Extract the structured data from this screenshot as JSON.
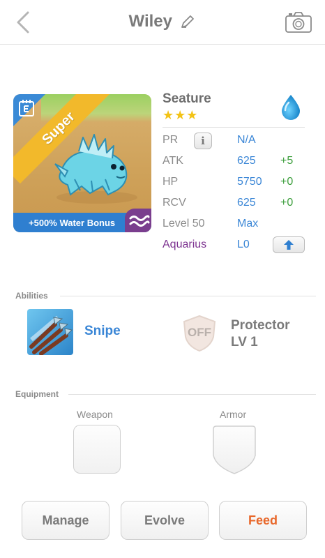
{
  "header": {
    "title": "Wiley",
    "back_icon": "chevron-left-icon",
    "edit_icon": "pencil-icon",
    "camera_icon": "camera-icon"
  },
  "monster": {
    "name": "Seature",
    "rarity_label": "Super",
    "stars": "★★★",
    "element_icon": "water-drop-icon",
    "bonus": "+500% Water Bonus",
    "stats": {
      "pr": {
        "label": "PR",
        "value": "N/A"
      },
      "atk": {
        "label": "ATK",
        "value": "625",
        "bonus": "+5"
      },
      "hp": {
        "label": "HP",
        "value": "5750",
        "bonus": "+0"
      },
      "rcv": {
        "label": "RCV",
        "value": "625",
        "bonus": "+0"
      },
      "level": {
        "label": "Level 50",
        "value": "Max"
      },
      "zodiac": {
        "label": "Aquarius",
        "value": "L0"
      }
    }
  },
  "abilities": {
    "section_title": "Abilities",
    "items": [
      {
        "name": "Snipe",
        "icon": "arrows-icon"
      },
      {
        "name_line1": "Protector",
        "name_line2": "LV 1",
        "status": "OFF",
        "icon": "shield-off-icon"
      }
    ]
  },
  "equipment": {
    "section_title": "Equipment",
    "weapon_label": "Weapon",
    "armor_label": "Armor"
  },
  "actions": {
    "manage": "Manage",
    "evolve": "Evolve",
    "feed": "Feed"
  },
  "colors": {
    "accent_blue": "#3a86d6",
    "bonus_green": "#3c9e3c",
    "zodiac_purple": "#7d3390",
    "feed_orange": "#e8672a",
    "star_gold": "#f3c316"
  }
}
